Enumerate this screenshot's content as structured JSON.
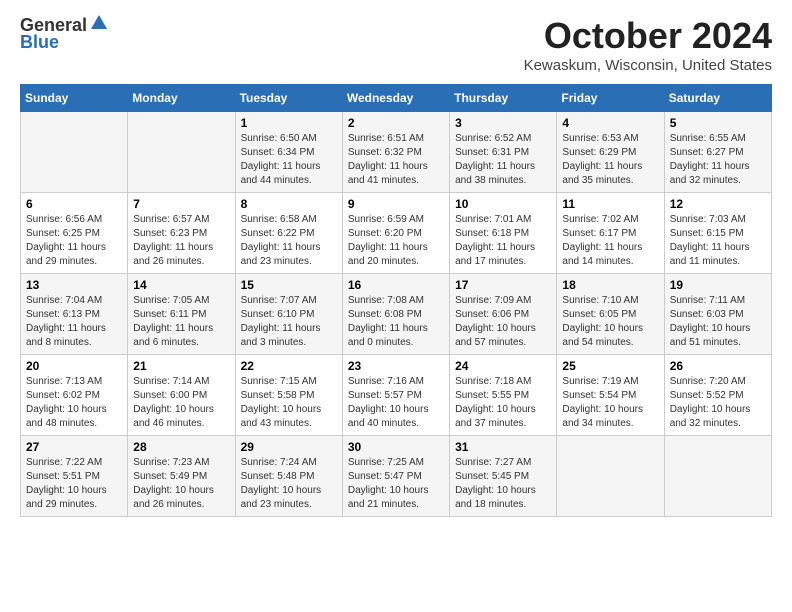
{
  "header": {
    "logo_general": "General",
    "logo_blue": "Blue",
    "month": "October 2024",
    "location": "Kewaskum, Wisconsin, United States"
  },
  "days_of_week": [
    "Sunday",
    "Monday",
    "Tuesday",
    "Wednesday",
    "Thursday",
    "Friday",
    "Saturday"
  ],
  "weeks": [
    [
      {
        "day": "",
        "info": ""
      },
      {
        "day": "",
        "info": ""
      },
      {
        "day": "1",
        "info": "Sunrise: 6:50 AM\nSunset: 6:34 PM\nDaylight: 11 hours\nand 44 minutes."
      },
      {
        "day": "2",
        "info": "Sunrise: 6:51 AM\nSunset: 6:32 PM\nDaylight: 11 hours\nand 41 minutes."
      },
      {
        "day": "3",
        "info": "Sunrise: 6:52 AM\nSunset: 6:31 PM\nDaylight: 11 hours\nand 38 minutes."
      },
      {
        "day": "4",
        "info": "Sunrise: 6:53 AM\nSunset: 6:29 PM\nDaylight: 11 hours\nand 35 minutes."
      },
      {
        "day": "5",
        "info": "Sunrise: 6:55 AM\nSunset: 6:27 PM\nDaylight: 11 hours\nand 32 minutes."
      }
    ],
    [
      {
        "day": "6",
        "info": "Sunrise: 6:56 AM\nSunset: 6:25 PM\nDaylight: 11 hours\nand 29 minutes."
      },
      {
        "day": "7",
        "info": "Sunrise: 6:57 AM\nSunset: 6:23 PM\nDaylight: 11 hours\nand 26 minutes."
      },
      {
        "day": "8",
        "info": "Sunrise: 6:58 AM\nSunset: 6:22 PM\nDaylight: 11 hours\nand 23 minutes."
      },
      {
        "day": "9",
        "info": "Sunrise: 6:59 AM\nSunset: 6:20 PM\nDaylight: 11 hours\nand 20 minutes."
      },
      {
        "day": "10",
        "info": "Sunrise: 7:01 AM\nSunset: 6:18 PM\nDaylight: 11 hours\nand 17 minutes."
      },
      {
        "day": "11",
        "info": "Sunrise: 7:02 AM\nSunset: 6:17 PM\nDaylight: 11 hours\nand 14 minutes."
      },
      {
        "day": "12",
        "info": "Sunrise: 7:03 AM\nSunset: 6:15 PM\nDaylight: 11 hours\nand 11 minutes."
      }
    ],
    [
      {
        "day": "13",
        "info": "Sunrise: 7:04 AM\nSunset: 6:13 PM\nDaylight: 11 hours\nand 8 minutes."
      },
      {
        "day": "14",
        "info": "Sunrise: 7:05 AM\nSunset: 6:11 PM\nDaylight: 11 hours\nand 6 minutes."
      },
      {
        "day": "15",
        "info": "Sunrise: 7:07 AM\nSunset: 6:10 PM\nDaylight: 11 hours\nand 3 minutes."
      },
      {
        "day": "16",
        "info": "Sunrise: 7:08 AM\nSunset: 6:08 PM\nDaylight: 11 hours\nand 0 minutes."
      },
      {
        "day": "17",
        "info": "Sunrise: 7:09 AM\nSunset: 6:06 PM\nDaylight: 10 hours\nand 57 minutes."
      },
      {
        "day": "18",
        "info": "Sunrise: 7:10 AM\nSunset: 6:05 PM\nDaylight: 10 hours\nand 54 minutes."
      },
      {
        "day": "19",
        "info": "Sunrise: 7:11 AM\nSunset: 6:03 PM\nDaylight: 10 hours\nand 51 minutes."
      }
    ],
    [
      {
        "day": "20",
        "info": "Sunrise: 7:13 AM\nSunset: 6:02 PM\nDaylight: 10 hours\nand 48 minutes."
      },
      {
        "day": "21",
        "info": "Sunrise: 7:14 AM\nSunset: 6:00 PM\nDaylight: 10 hours\nand 46 minutes."
      },
      {
        "day": "22",
        "info": "Sunrise: 7:15 AM\nSunset: 5:58 PM\nDaylight: 10 hours\nand 43 minutes."
      },
      {
        "day": "23",
        "info": "Sunrise: 7:16 AM\nSunset: 5:57 PM\nDaylight: 10 hours\nand 40 minutes."
      },
      {
        "day": "24",
        "info": "Sunrise: 7:18 AM\nSunset: 5:55 PM\nDaylight: 10 hours\nand 37 minutes."
      },
      {
        "day": "25",
        "info": "Sunrise: 7:19 AM\nSunset: 5:54 PM\nDaylight: 10 hours\nand 34 minutes."
      },
      {
        "day": "26",
        "info": "Sunrise: 7:20 AM\nSunset: 5:52 PM\nDaylight: 10 hours\nand 32 minutes."
      }
    ],
    [
      {
        "day": "27",
        "info": "Sunrise: 7:22 AM\nSunset: 5:51 PM\nDaylight: 10 hours\nand 29 minutes."
      },
      {
        "day": "28",
        "info": "Sunrise: 7:23 AM\nSunset: 5:49 PM\nDaylight: 10 hours\nand 26 minutes."
      },
      {
        "day": "29",
        "info": "Sunrise: 7:24 AM\nSunset: 5:48 PM\nDaylight: 10 hours\nand 23 minutes."
      },
      {
        "day": "30",
        "info": "Sunrise: 7:25 AM\nSunset: 5:47 PM\nDaylight: 10 hours\nand 21 minutes."
      },
      {
        "day": "31",
        "info": "Sunrise: 7:27 AM\nSunset: 5:45 PM\nDaylight: 10 hours\nand 18 minutes."
      },
      {
        "day": "",
        "info": ""
      },
      {
        "day": "",
        "info": ""
      }
    ]
  ]
}
